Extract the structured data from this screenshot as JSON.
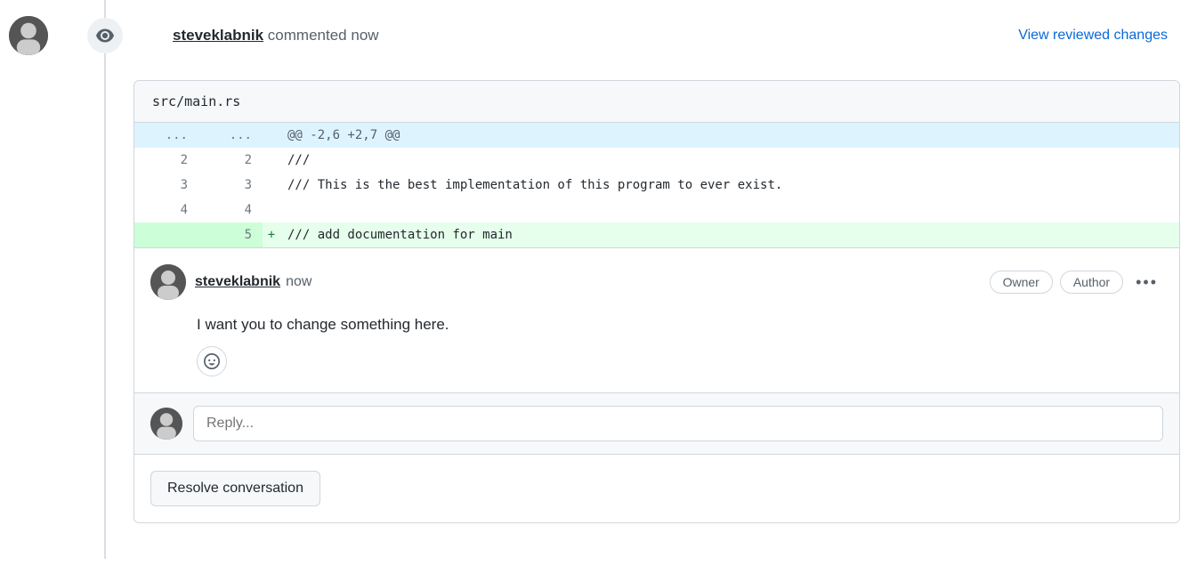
{
  "header": {
    "username": "steveklabnik",
    "action": "commented",
    "time": "now",
    "view_link": "View reviewed changes"
  },
  "file": {
    "path": "src/main.rs"
  },
  "diff": {
    "hunk_header": "@@ -2,6 +2,7 @@",
    "hunk_ellipsis": "...",
    "rows": [
      {
        "old": "2",
        "new": "2",
        "sign": " ",
        "code": "///",
        "type": "context"
      },
      {
        "old": "3",
        "new": "3",
        "sign": " ",
        "code": "/// This is the best implementation of this program to ever exist.",
        "type": "context"
      },
      {
        "old": "4",
        "new": "4",
        "sign": " ",
        "code": "",
        "type": "context"
      },
      {
        "old": "",
        "new": "5",
        "sign": "+",
        "code": "/// add documentation for main",
        "type": "add"
      }
    ]
  },
  "comment": {
    "username": "steveklabnik",
    "time": "now",
    "badges": {
      "owner": "Owner",
      "author": "Author"
    },
    "body": "I want you to change something here."
  },
  "reply": {
    "placeholder": "Reply..."
  },
  "resolve": {
    "label": "Resolve conversation"
  }
}
